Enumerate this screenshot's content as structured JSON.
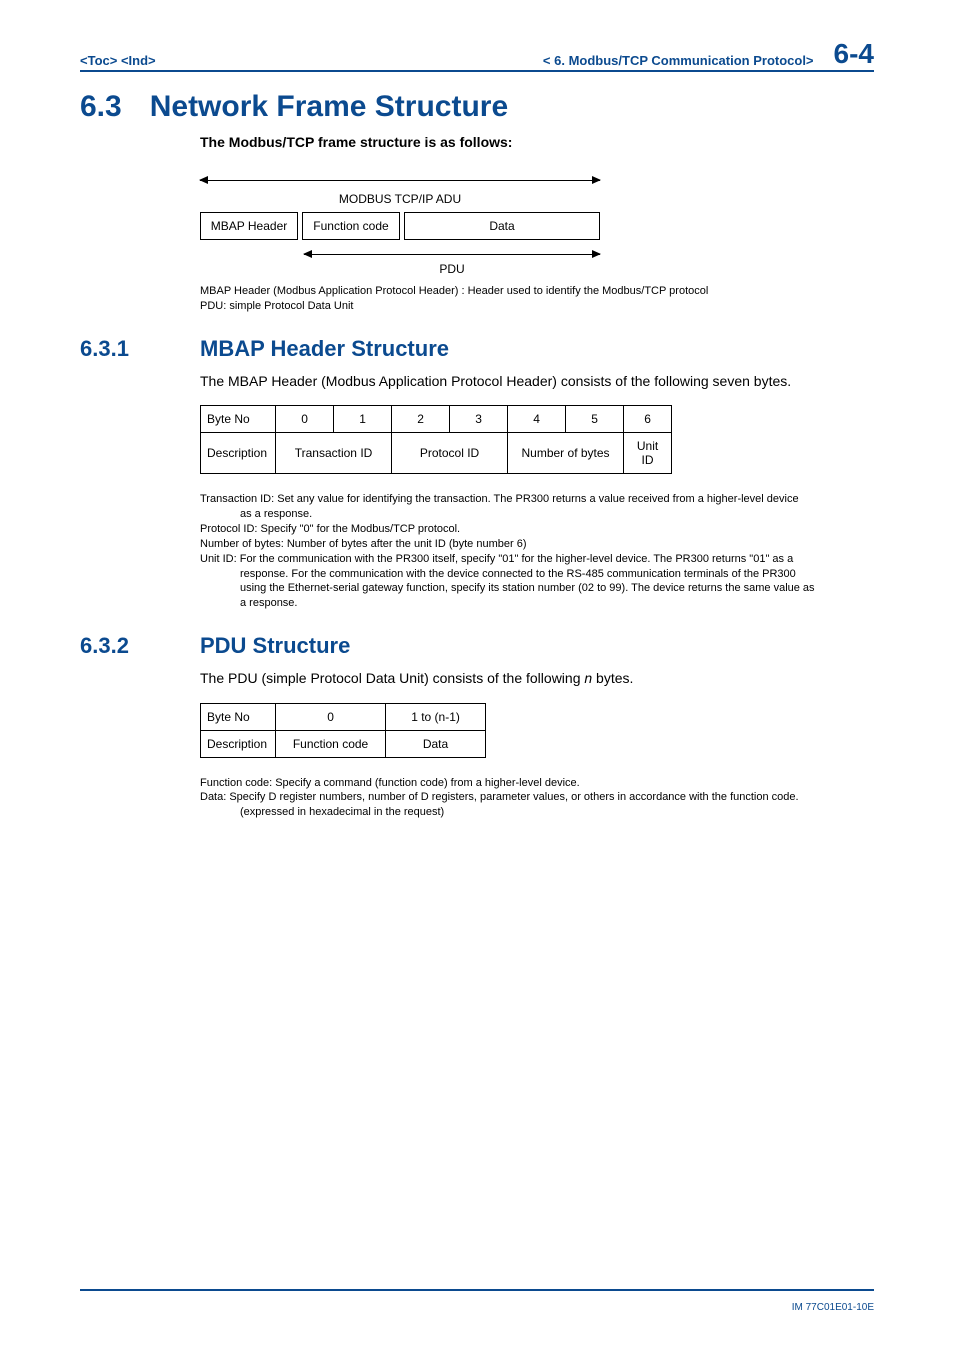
{
  "header": {
    "toc": "<Toc>",
    "ind": "<Ind>",
    "chapter": "< 6.  Modbus/TCP Communication Protocol>",
    "page": "6-4"
  },
  "section63": {
    "number": "6.3",
    "title": "Network Frame Structure",
    "intro": "The Modbus/TCP frame structure is as follows:"
  },
  "diagram": {
    "adu_label": "MODBUS TCP/IP ADU",
    "mbap": "MBAP Header",
    "func": "Function code",
    "data": "Data",
    "pdu_label": "PDU",
    "note1": "MBAP Header (Modbus Application Protocol Header) : Header used to identify the Modbus/TCP protocol",
    "note2": "PDU: simple Protocol Data Unit"
  },
  "section631": {
    "number": "6.3.1",
    "title": "MBAP Header Structure",
    "body": "The MBAP Header (Modbus Application Protocol Header) consists of the following seven bytes.",
    "table": {
      "row_label_byte": "Byte No",
      "row_label_desc": "Description",
      "bytes": [
        "0",
        "1",
        "2",
        "3",
        "4",
        "5",
        "6"
      ],
      "desc": {
        "trans": "Transaction ID",
        "proto": "Protocol ID",
        "num": "Number of bytes",
        "unit": "Unit ID"
      }
    },
    "notes": {
      "n1a": "Transaction ID: Set any value for identifying the transaction. The PR300 returns a value received from a higher-level device",
      "n1b": "as a response.",
      "n2": "Protocol ID: Specify \"0\" for the Modbus/TCP protocol.",
      "n3": "Number of bytes: Number of bytes after the unit ID (byte number 6)",
      "n4a": "Unit ID: For the communication with the PR300 itself, specify \"01\" for the higher-level device. The PR300 returns \"01\" as a",
      "n4b": "response. For the communication with the device connected to the RS-485 communication terminals of the PR300",
      "n4c": "using the Ethernet-serial gateway function, specify its station number (02 to 99). The device returns the same value as",
      "n4d": "a response."
    }
  },
  "section632": {
    "number": "6.3.2",
    "title": "PDU Structure",
    "body_pre": "The PDU (simple Protocol Data Unit) consists of the following ",
    "body_n": "n",
    "body_post": " bytes.",
    "table": {
      "row_label_byte": "Byte No",
      "row_label_desc": "Description",
      "col0": "0",
      "col1": "1 to (n-1)",
      "desc0": "Function code",
      "desc1": "Data"
    },
    "notes": {
      "n1": "Function code: Specify a command (function code) from a higher-level device.",
      "n2a": "Data: Specify D register numbers, number of D registers, parameter values, or others in accordance with the function code.",
      "n2b": "(expressed in hexadecimal in the request)"
    }
  },
  "footer": {
    "doc": "IM 77C01E01-10E"
  }
}
